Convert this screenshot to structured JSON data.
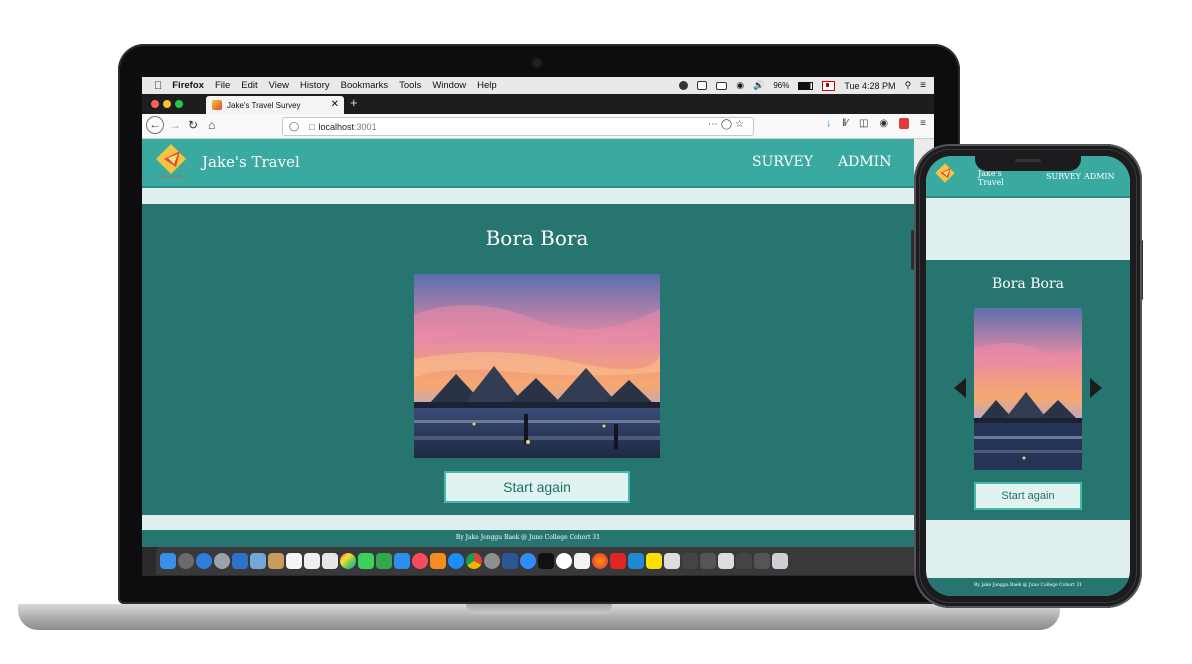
{
  "menubar": {
    "app": "Firefox",
    "items": [
      "File",
      "Edit",
      "View",
      "History",
      "Bookmarks",
      "Tools",
      "Window",
      "Help"
    ],
    "battery": "96%",
    "clock": "Tue 4:28 PM"
  },
  "browser": {
    "tab_title": "Jake's Travel Survey",
    "url_host": "localhost",
    "url_port": ":3001"
  },
  "site": {
    "brand": "Jake's Travel",
    "logo_caption": "JAKE'S TRAVEL",
    "nav": [
      "SURVEY",
      "ADMIN"
    ],
    "destination": "Bora Bora",
    "start_again": "Start again",
    "footer": "By Jake Jonggu Baek @ Juno College Cohort 31"
  },
  "phone_site": {
    "brand": "Jake's Travel",
    "nav": [
      "SURVEY",
      "ADMIN"
    ],
    "destination": "Bora Bora",
    "start_again": "Start again",
    "footer": "By Jake Jonggu Baek @ Juno College Cohort 31"
  },
  "colors": {
    "header": "#3aa9a0",
    "main": "#277570",
    "light": "#deefee",
    "button_bg": "#e1f3f1",
    "button_border": "#47b7aa"
  },
  "icons": [
    "apple-icon",
    "search-icon",
    "back-icon",
    "forward-icon",
    "reload-icon",
    "home-icon",
    "shield-icon",
    "page-icon",
    "bookmark-star-icon",
    "download-icon",
    "library-icon",
    "sidebar-icon",
    "menu-icon",
    "chevron-left-icon",
    "chevron-right-icon",
    "logo-icon"
  ]
}
